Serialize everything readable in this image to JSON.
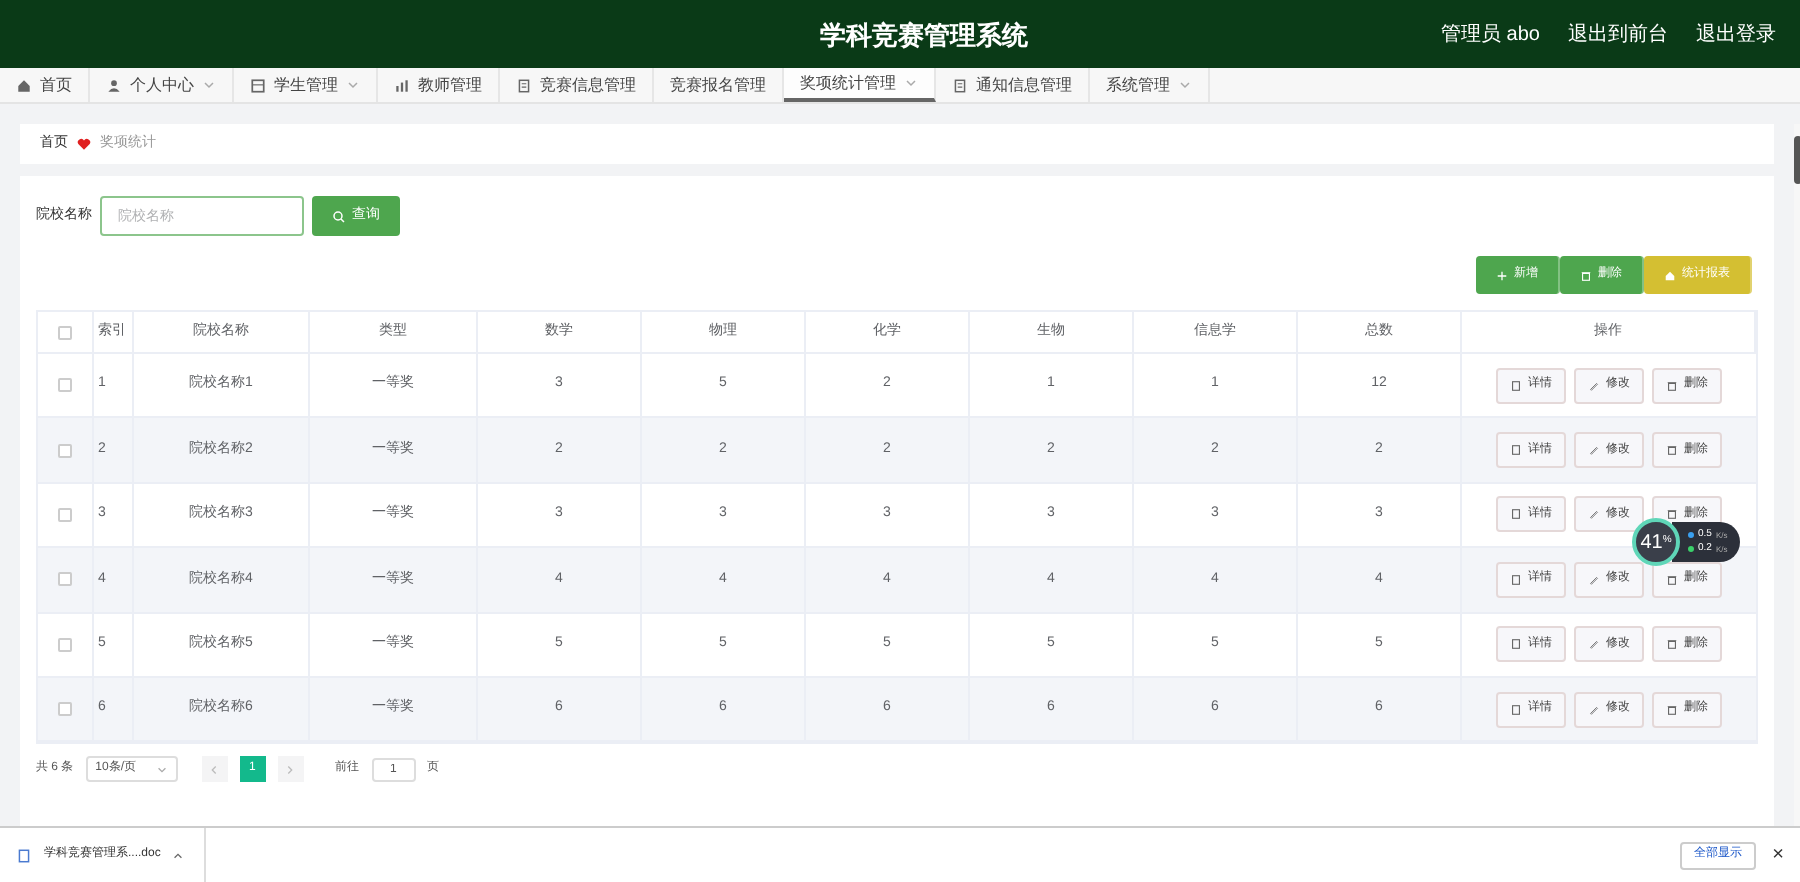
{
  "header": {
    "title": "学科竞赛管理系统",
    "user": "管理员 abo",
    "links": [
      "退出到前台",
      "退出登录"
    ]
  },
  "nav": [
    {
      "label": "首页",
      "kind": "home",
      "selected": false,
      "dropdown": false
    },
    {
      "label": "个人中心",
      "kind": "user",
      "selected": false,
      "dropdown": true
    },
    {
      "label": "学生管理",
      "kind": "grid",
      "selected": false,
      "dropdown": true
    },
    {
      "label": "教师管理",
      "kind": "chart",
      "selected": false,
      "dropdown": false
    },
    {
      "label": "竞赛信息管理",
      "kind": "doc",
      "selected": false,
      "dropdown": false
    },
    {
      "label": "竞赛报名管理",
      "kind": "plain",
      "selected": false,
      "dropdown": false
    },
    {
      "label": "奖项统计管理",
      "kind": "plain",
      "selected": true,
      "dropdown": true
    },
    {
      "label": "通知信息管理",
      "kind": "doc",
      "selected": false,
      "dropdown": false
    },
    {
      "label": "系统管理",
      "kind": "plain",
      "selected": false,
      "dropdown": true
    }
  ],
  "breadcrumb": [
    "首页",
    "奖项统计"
  ],
  "search": {
    "label": "院校名称",
    "placeholder": "院校名称",
    "button": "查询"
  },
  "actions": [
    {
      "label": "新增",
      "kind": "add"
    },
    {
      "label": "删除",
      "kind": "delete"
    },
    {
      "label": "统计报表",
      "kind": "report"
    }
  ],
  "table": {
    "select_all_checked": false,
    "columns": [
      "索引",
      "院校名称",
      "类型",
      "数学",
      "物理",
      "化学",
      "生物",
      "信息学",
      "总数",
      "操作"
    ],
    "rows": [
      {
        "checked": false,
        "cells": [
          "1",
          "院校名称1",
          "一等奖",
          "3",
          "5",
          "2",
          "1",
          "1",
          "12"
        ],
        "buttons": [
          "详情",
          "修改",
          "删除"
        ]
      },
      {
        "checked": false,
        "cells": [
          "2",
          "院校名称2",
          "一等奖",
          "2",
          "2",
          "2",
          "2",
          "2",
          "2"
        ],
        "buttons": [
          "详情",
          "修改",
          "删除"
        ]
      },
      {
        "checked": false,
        "cells": [
          "3",
          "院校名称3",
          "一等奖",
          "3",
          "3",
          "3",
          "3",
          "3",
          "3"
        ],
        "buttons": [
          "详情",
          "修改",
          "删除"
        ]
      },
      {
        "checked": false,
        "cells": [
          "4",
          "院校名称4",
          "一等奖",
          "4",
          "4",
          "4",
          "4",
          "4",
          "4"
        ],
        "buttons": [
          "详情",
          "修改",
          "删除"
        ]
      },
      {
        "checked": false,
        "cells": [
          "5",
          "院校名称5",
          "一等奖",
          "5",
          "5",
          "5",
          "5",
          "5",
          "5"
        ],
        "buttons": [
          "详情",
          "修改",
          "删除"
        ]
      },
      {
        "checked": false,
        "cells": [
          "6",
          "院校名称6",
          "一等奖",
          "6",
          "6",
          "6",
          "6",
          "6",
          "6"
        ],
        "buttons": [
          "详情",
          "修改",
          "删除"
        ]
      }
    ]
  },
  "pagination": {
    "total": "共 6 条",
    "page_size": "10条/页",
    "pages": [
      {
        "label": "1",
        "selected": true
      }
    ],
    "goto_label": "前往",
    "goto_value": "1",
    "goto_suffix": "页"
  },
  "speed_widget": {
    "percent": "41",
    "unit": "%",
    "up": "0.5",
    "up_unit": "K/s",
    "down": "0.2",
    "down_unit": "K/s"
  },
  "download_bar": {
    "file": "学科竞赛管理系....doc",
    "show_all": "全部显示",
    "close": "×"
  }
}
